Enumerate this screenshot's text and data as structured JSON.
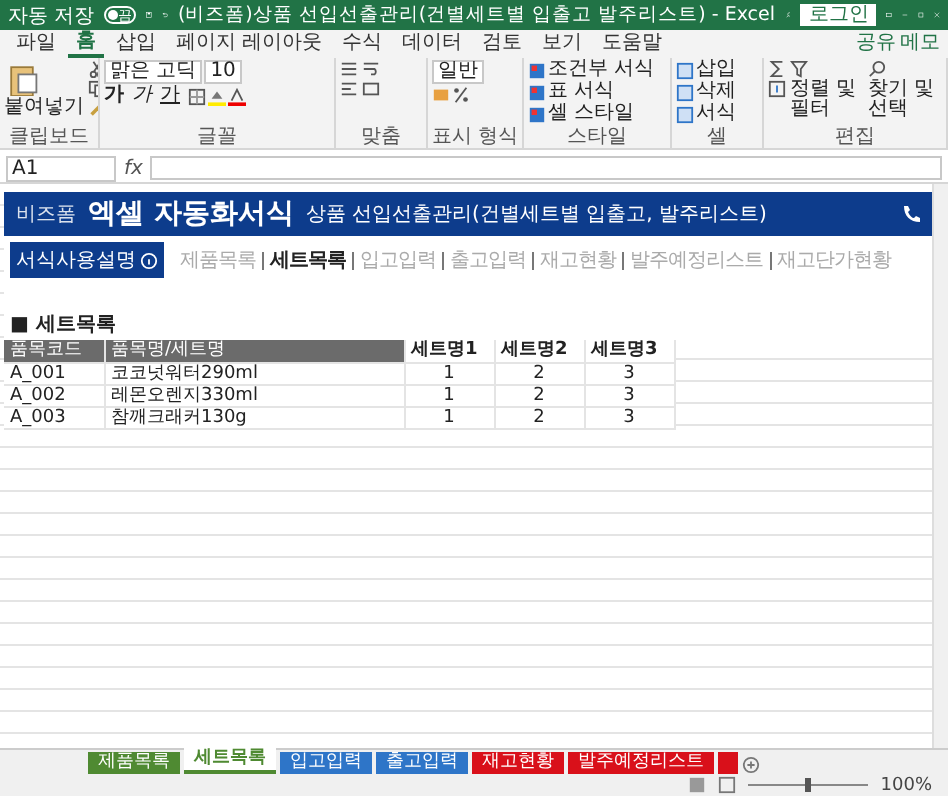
{
  "window": {
    "title": "(비즈폼)상품 선입선출관리(건별세트별 입출고 발주리스트) - Excel",
    "autosave": {
      "label": "자동 저장",
      "on": false,
      "state": "끔"
    },
    "login": "로그인"
  },
  "menu_tabs": [
    {
      "label": "파일",
      "selected": false
    },
    {
      "label": "홈",
      "selected": true
    },
    {
      "label": "삽입",
      "selected": false
    },
    {
      "label": "페이지 레이아웃",
      "selected": false
    },
    {
      "label": "수식",
      "selected": false
    },
    {
      "label": "데이터",
      "selected": false
    },
    {
      "label": "검토",
      "selected": false
    },
    {
      "label": "보기",
      "selected": false
    },
    {
      "label": "도움말",
      "selected": false
    }
  ],
  "share": "공유",
  "memo": "메모",
  "ribbon": {
    "paste": "붙여넣기",
    "font": "맑은 고딕",
    "size": "10",
    "format_buttons": [
      "가",
      "가",
      "가"
    ],
    "number_format": "일반",
    "styles": [
      "조건부 서식",
      "표 서식",
      "셀 스타일"
    ],
    "cells": [
      "삽입",
      "삭제",
      "서식"
    ],
    "editing": [
      "정렬 및 필터",
      "찾기 및 선택"
    ],
    "groups": [
      "클립보드",
      "글꼴",
      "맞춤",
      "표시 형식",
      "스타일",
      "셀",
      "편집"
    ]
  },
  "formula_bar": {
    "name_box": "A1",
    "fx": "fx"
  },
  "banner": {
    "brand": "비즈폼",
    "title": "엑셀 자동화서식",
    "subtitle": "상품 선입선출관리(건별세트별 입출고, 발주리스트)"
  },
  "guide_button": "서식사용설명",
  "nav": [
    {
      "label": "제품목록",
      "selected": false
    },
    {
      "label": "세트목록",
      "selected": true
    },
    {
      "label": "입고입력",
      "selected": false
    },
    {
      "label": "출고입력",
      "selected": false
    },
    {
      "label": "재고현황",
      "selected": false
    },
    {
      "label": "발주예정리스트",
      "selected": false
    },
    {
      "label": "재고단가현황",
      "selected": false
    }
  ],
  "section_title": "■ 세트목록",
  "table": {
    "columns": [
      "품목코드",
      "품목명/세트명",
      "세트명1",
      "세트명2",
      "세트명3"
    ],
    "rows": [
      [
        "A_001",
        "코코넛워터290ml",
        "1",
        "2",
        "3"
      ],
      [
        "A_002",
        "레몬오렌지330ml",
        "1",
        "2",
        "3"
      ],
      [
        "A_003",
        "참깨크래커130g",
        "1",
        "2",
        "3"
      ]
    ]
  },
  "sheet_tabs": [
    {
      "label": "제품목록",
      "color": "#4f8a32",
      "selected": false
    },
    {
      "label": "세트목록",
      "color": "#4f8a32",
      "selected": true
    },
    {
      "label": "입고입력",
      "color": "#2e75c8",
      "selected": false
    },
    {
      "label": "출고입력",
      "color": "#2e75c8",
      "selected": false
    },
    {
      "label": "재고현황",
      "color": "#d9101a",
      "selected": false
    },
    {
      "label": "발주예정리스트",
      "color": "#d9101a",
      "selected": false
    },
    {
      "color": "#d9101a",
      "selected": false
    }
  ],
  "status_bar": {
    "zoom": {
      "level": 0.5,
      "reading": "100%"
    }
  }
}
